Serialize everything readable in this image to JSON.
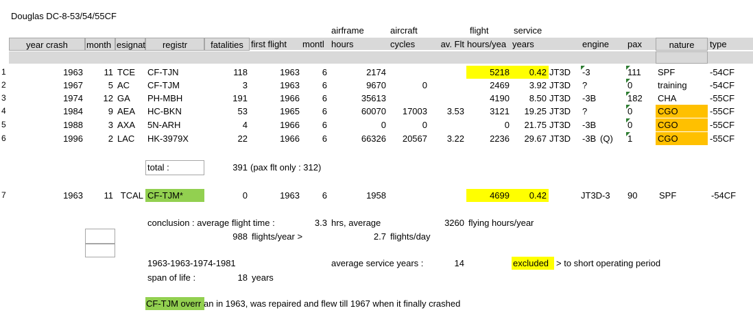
{
  "sheet_title": "Douglas DC-8-53/54/55CF",
  "header_top": {
    "airframe": "airframe",
    "aircraft": "aircraft",
    "flight": "flight",
    "service": "service"
  },
  "header": {
    "year_crash": "year crash",
    "month": "month",
    "designat": "esignat",
    "registr": "registr",
    "fatalities": "fatalities",
    "first_flight": "first flight",
    "month2": "montl",
    "hours": "hours",
    "cycles": "cycles",
    "av_flt": "av. Flt",
    "hours_year": "hours/yea",
    "years": "years",
    "engine": "engine",
    "pax": "pax",
    "nature": "nature",
    "type": "type"
  },
  "rows": [
    {
      "num": "1",
      "year": "1963",
      "month": "11",
      "op": "TCE",
      "reg": "CF-TJN",
      "fat": "118",
      "ff": "1963",
      "ffm": "6",
      "hours": "2174",
      "cycles": "",
      "avflt": "",
      "hy": "5218",
      "sy": "0.42",
      "eng": "JT3D",
      "engsub": "-3",
      "q": "",
      "pax": "111",
      "nature": "SPF",
      "type": "-54CF"
    },
    {
      "num": "2",
      "year": "1967",
      "month": "5",
      "op": "AC",
      "reg": "CF-TJM",
      "fat": "3",
      "ff": "1963",
      "ffm": "6",
      "hours": "9670",
      "cycles": "0",
      "avflt": "",
      "hy": "2469",
      "sy": "3.92",
      "eng": "JT3D",
      "engsub": "?",
      "q": "",
      "pax": "0",
      "nature": "training",
      "type": "-54CF"
    },
    {
      "num": "3",
      "year": "1974",
      "month": "12",
      "op": "GA",
      "reg": "PH-MBH",
      "fat": "191",
      "ff": "1966",
      "ffm": "6",
      "hours": "35613",
      "cycles": "",
      "avflt": "",
      "hy": "4190",
      "sy": "8.50",
      "eng": "JT3D",
      "engsub": "-3B",
      "q": "",
      "pax": "182",
      "nature": "CHA",
      "type": "-55CF"
    },
    {
      "num": "4",
      "year": "1984",
      "month": "9",
      "op": "AEA",
      "reg": "HC-BKN",
      "fat": "53",
      "ff": "1965",
      "ffm": "6",
      "hours": "60070",
      "cycles": "17003",
      "avflt": "3.53",
      "hy": "3121",
      "sy": "19.25",
      "eng": "JT3D",
      "engsub": "?",
      "q": "",
      "pax": "0",
      "nature": "CGO",
      "type": "-55CF"
    },
    {
      "num": "5",
      "year": "1988",
      "month": "3",
      "op": "AXA",
      "reg": "5N-ARH",
      "fat": "4",
      "ff": "1966",
      "ffm": "6",
      "hours": "0",
      "cycles": "0",
      "avflt": "",
      "hy": "0",
      "sy": "21.75",
      "eng": "JT3D",
      "engsub": "-3B",
      "q": "",
      "pax": "0",
      "nature": "CGO",
      "type": "-55CF"
    },
    {
      "num": "6",
      "year": "1996",
      "month": "2",
      "op": "LAC",
      "reg": "HK-3979X",
      "fat": "22",
      "ff": "1966",
      "ffm": "6",
      "hours": "66326",
      "cycles": "20567",
      "avflt": "3.22",
      "hy": "2236",
      "sy": "29.67",
      "eng": "JT3D",
      "engsub": "-3B",
      "q": "(Q)",
      "pax": "1",
      "nature": "CGO",
      "type": "-55CF"
    }
  ],
  "total": {
    "label": "total :",
    "value": "391",
    "note": "(pax flt only : 312)"
  },
  "row7": {
    "num": "7",
    "year": "1963",
    "month": "11",
    "op": "TCAL",
    "reg": "CF-TJM*",
    "fat": "0",
    "ff": "1963",
    "ffm": "6",
    "hours": "1958",
    "hy": "4699",
    "sy": "0.42",
    "eng": "JT3D-3",
    "pax": "90",
    "nature": "SPF",
    "type": "-54CF"
  },
  "conclusion": {
    "label": "conclusion : average flight time :",
    "avg_time": "3.3",
    "hrs_avg": "hrs, average",
    "avg_hours": "3260",
    "flying_hours": "flying hours/year",
    "flights_year_val": "988",
    "flights_year": "flights/year >",
    "flights_day_val": "2.7",
    "flights_day": "flights/day"
  },
  "years_range": "1963-1963-1974-1981",
  "avg_service_label": "average service years :",
  "avg_service_val": "14",
  "excluded": "excluded",
  "excluded_note": "> to short operating period",
  "span_label": "span of life :",
  "span_val": "18",
  "span_unit": "years",
  "footnote_reg": "CF-TJM overr",
  "footnote_rest": "an in 1963, was repaired and flew till 1967 when it finally crashed",
  "colors": {
    "yellow": "#ffff00",
    "orange": "#ffc000",
    "green": "#92d050",
    "header": "#d9d9d9"
  }
}
